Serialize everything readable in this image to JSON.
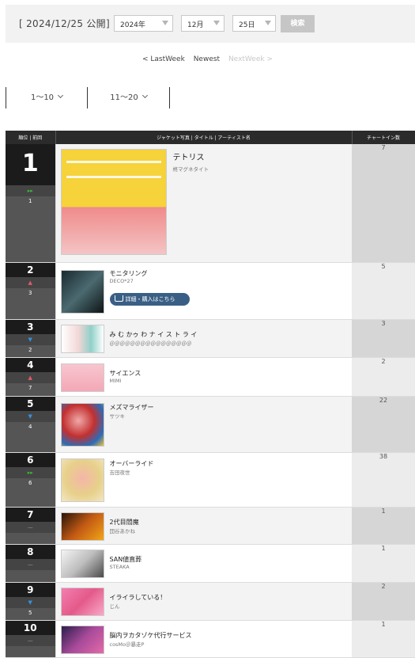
{
  "header": {
    "date_label": "[ 2024/12/25 公開]",
    "year": "2024年",
    "month": "12月",
    "day": "25日",
    "search_label": "検索"
  },
  "week_nav": {
    "last": "< LastWeek",
    "newest": "Newest",
    "next": "NextWeek >"
  },
  "range_tabs": [
    "1〜10",
    "11〜20"
  ],
  "table_headers": {
    "rank": "順位 | 前回",
    "info": "ジャケット写真 | タイトル | アーティスト名",
    "count": "チャートイン数"
  },
  "buy_label": "詳細・購入はこちら",
  "colors": {
    "header_bg": "#2b2b2b",
    "buy_button": "#3a5f85",
    "up": "#e05a6a",
    "down": "#3a8fd8",
    "new": "#3cba3c"
  },
  "entries": [
    {
      "rank": "1",
      "move": "new",
      "move_icon": "▸▸",
      "prev": "1",
      "title": "テトリス",
      "artist": "柊マグネタイト",
      "count": "7"
    },
    {
      "rank": "2",
      "move": "up",
      "move_icon": "▲",
      "prev": "3",
      "title": "モニタリング",
      "artist": "DECO*27",
      "count": "5"
    },
    {
      "rank": "3",
      "move": "down",
      "move_icon": "▼",
      "prev": "2",
      "title": "み む かゥ わ ナ イ ス ト ラ イ",
      "artist": "＠＠＠＠＠＠＠＠＠＠＠＠＠＠＠＠",
      "count": "3"
    },
    {
      "rank": "4",
      "move": "up",
      "move_icon": "▲",
      "prev": "7",
      "title": "サイエンス",
      "artist": "MIMI",
      "count": "2"
    },
    {
      "rank": "5",
      "move": "down",
      "move_icon": "▼",
      "prev": "4",
      "title": "メズマライザー",
      "artist": "サツキ",
      "count": "22"
    },
    {
      "rank": "6",
      "move": "new",
      "move_icon": "▸▸",
      "prev": "6",
      "title": "オーバーライド",
      "artist": "吉田夜世",
      "count": "38"
    },
    {
      "rank": "7",
      "move": "stay",
      "move_icon": "—",
      "prev": "",
      "title": "2代目閻魔",
      "artist": "団谷あかね",
      "count": "1"
    },
    {
      "rank": "8",
      "move": "stay",
      "move_icon": "—",
      "prev": "",
      "title": "SAN値直葬",
      "artist": "STEAKA",
      "count": "1"
    },
    {
      "rank": "9",
      "move": "down",
      "move_icon": "▼",
      "prev": "5",
      "title": "イライラしている！",
      "artist": "じん",
      "count": "2"
    },
    {
      "rank": "10",
      "move": "stay",
      "move_icon": "—",
      "prev": "",
      "title": "脳内ヲカタゾケ代行サービス",
      "artist": "cosMo＠暴走P",
      "count": "1"
    }
  ]
}
